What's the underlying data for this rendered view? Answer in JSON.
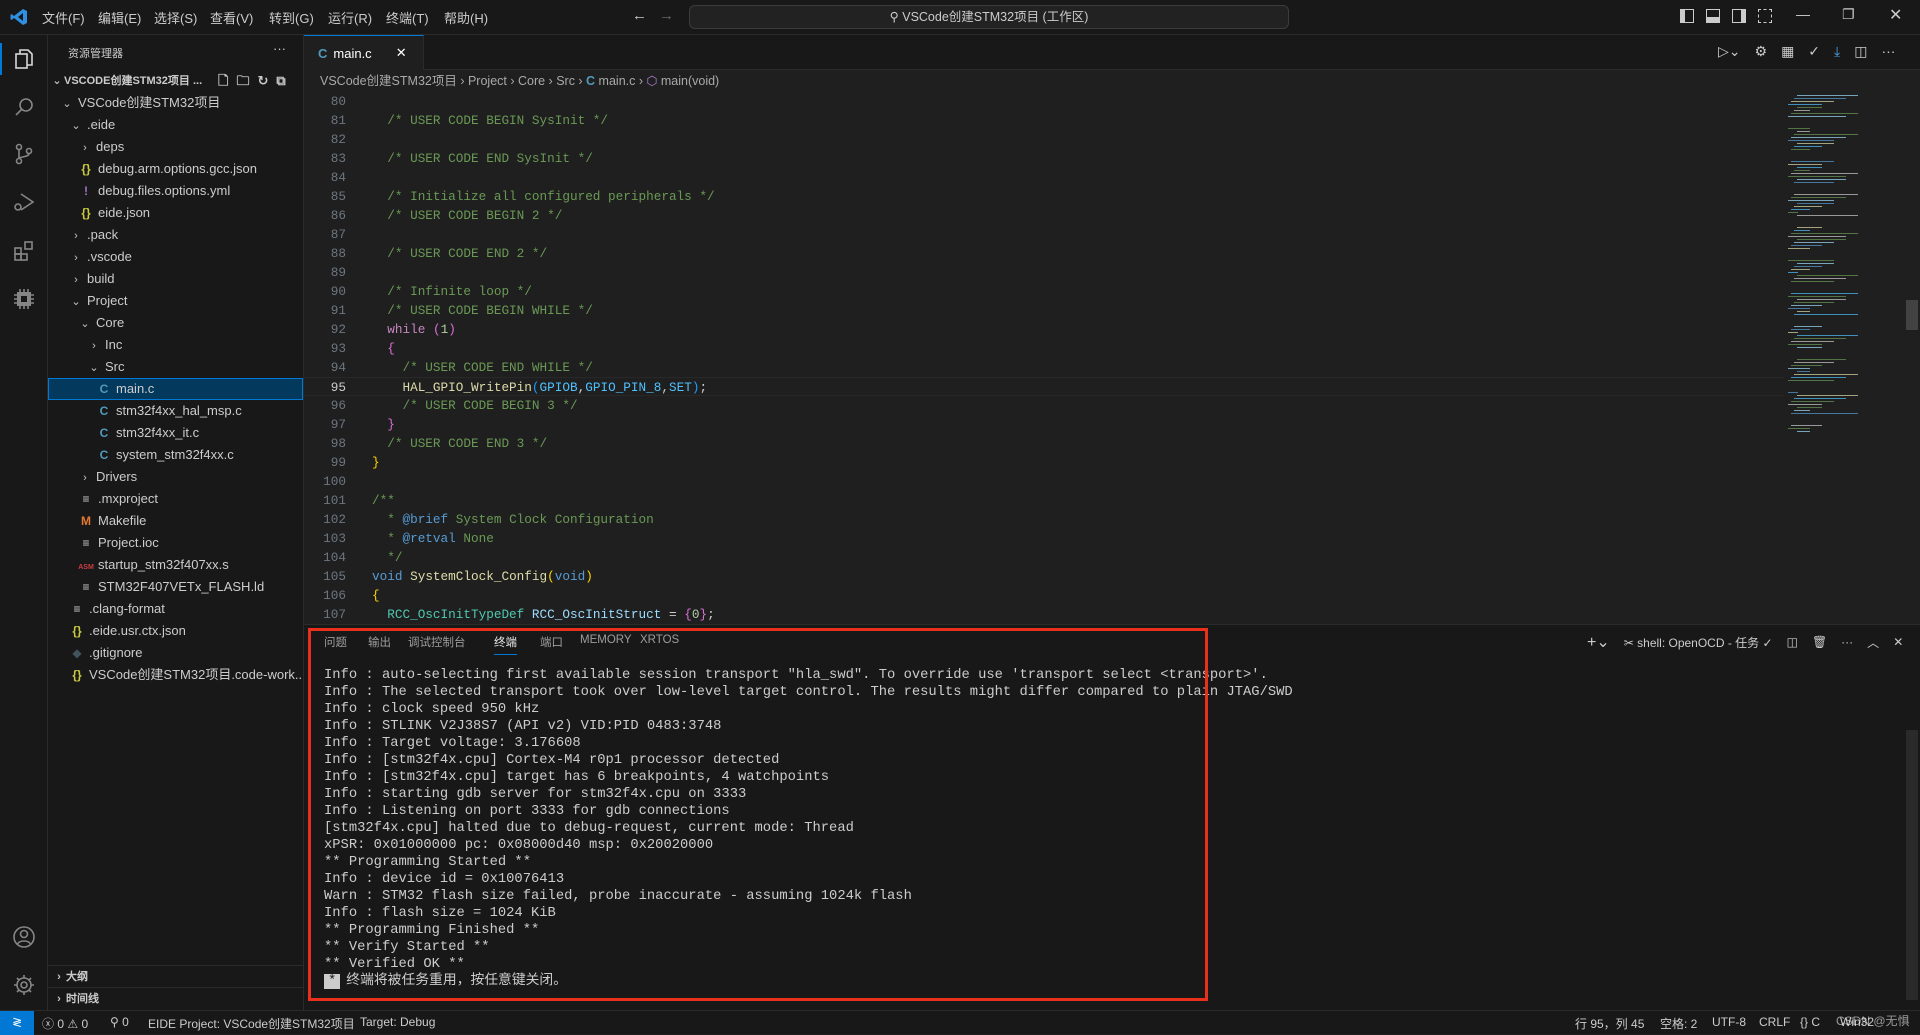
{
  "titlebar": {
    "menus": [
      "文件(F)",
      "编辑(E)",
      "选择(S)",
      "查看(V)",
      "转到(G)",
      "运行(R)",
      "终端(T)",
      "帮助(H)"
    ],
    "search_text": "VSCode创建STM32项目 (工作区)"
  },
  "sidebar": {
    "title": "资源管理器",
    "root": "VSCODE创建STM32项目 ...",
    "items": [
      {
        "label": "VSCode创建STM32项目",
        "level": 0,
        "kind": "folder-open"
      },
      {
        "label": ".eide",
        "level": 1,
        "kind": "folder-open"
      },
      {
        "label": "deps",
        "level": 2,
        "kind": "folder"
      },
      {
        "label": "debug.arm.options.gcc.json",
        "level": 2,
        "kind": "json"
      },
      {
        "label": "debug.files.options.yml",
        "level": 2,
        "kind": "yml"
      },
      {
        "label": "eide.json",
        "level": 2,
        "kind": "json"
      },
      {
        "label": ".pack",
        "level": 1,
        "kind": "folder"
      },
      {
        "label": ".vscode",
        "level": 1,
        "kind": "folder"
      },
      {
        "label": "build",
        "level": 1,
        "kind": "folder"
      },
      {
        "label": "Project",
        "level": 1,
        "kind": "folder-open"
      },
      {
        "label": "Core",
        "level": 2,
        "kind": "folder-open"
      },
      {
        "label": "Inc",
        "level": 3,
        "kind": "folder"
      },
      {
        "label": "Src",
        "level": 3,
        "kind": "folder-open"
      },
      {
        "label": "main.c",
        "level": 4,
        "kind": "c",
        "selected": true
      },
      {
        "label": "stm32f4xx_hal_msp.c",
        "level": 4,
        "kind": "c"
      },
      {
        "label": "stm32f4xx_it.c",
        "level": 4,
        "kind": "c"
      },
      {
        "label": "system_stm32f4xx.c",
        "level": 4,
        "kind": "c"
      },
      {
        "label": "Drivers",
        "level": 2,
        "kind": "folder"
      },
      {
        "label": ".mxproject",
        "level": 2,
        "kind": "text"
      },
      {
        "label": "Makefile",
        "level": 2,
        "kind": "makefile"
      },
      {
        "label": "Project.ioc",
        "level": 2,
        "kind": "text"
      },
      {
        "label": "startup_stm32f407xx.s",
        "level": 2,
        "kind": "asm"
      },
      {
        "label": "STM32F407VETx_FLASH.ld",
        "level": 2,
        "kind": "text"
      },
      {
        "label": ".clang-format",
        "level": 1,
        "kind": "text"
      },
      {
        "label": ".eide.usr.ctx.json",
        "level": 1,
        "kind": "json"
      },
      {
        "label": ".gitignore",
        "level": 1,
        "kind": "git"
      },
      {
        "label": "VSCode创建STM32项目.code-work...",
        "level": 1,
        "kind": "json"
      }
    ],
    "outline": "大纲",
    "timeline": "时间线"
  },
  "editor": {
    "tab_label": "main.c",
    "breadcrumb": [
      "VSCode创建STM32项目",
      "Project",
      "Core",
      "Src",
      "main.c",
      "main(void)"
    ],
    "current_line": 95,
    "lines": [
      {
        "n": 80,
        "t": []
      },
      {
        "n": 81,
        "t": [
          [
            "  ",
            "plain"
          ],
          [
            "/* USER CODE BEGIN SysInit */",
            "comment"
          ]
        ]
      },
      {
        "n": 82,
        "t": []
      },
      {
        "n": 83,
        "t": [
          [
            "  ",
            "plain"
          ],
          [
            "/* USER CODE END SysInit */",
            "comment"
          ]
        ]
      },
      {
        "n": 84,
        "t": []
      },
      {
        "n": 85,
        "t": [
          [
            "  ",
            "plain"
          ],
          [
            "/* Initialize all configured peripherals */",
            "comment"
          ]
        ]
      },
      {
        "n": 86,
        "t": [
          [
            "  ",
            "plain"
          ],
          [
            "/* USER CODE BEGIN 2 */",
            "comment"
          ]
        ]
      },
      {
        "n": 87,
        "t": []
      },
      {
        "n": 88,
        "t": [
          [
            "  ",
            "plain"
          ],
          [
            "/* USER CODE END 2 */",
            "comment"
          ]
        ]
      },
      {
        "n": 89,
        "t": []
      },
      {
        "n": 90,
        "t": [
          [
            "  ",
            "plain"
          ],
          [
            "/* Infinite loop */",
            "comment"
          ]
        ]
      },
      {
        "n": 91,
        "t": [
          [
            "  ",
            "plain"
          ],
          [
            "/* USER CODE BEGIN WHILE */",
            "comment"
          ]
        ]
      },
      {
        "n": 92,
        "t": [
          [
            "  ",
            "plain"
          ],
          [
            "while",
            "control"
          ],
          [
            " ",
            "plain"
          ],
          [
            "(",
            "b2"
          ],
          [
            "1",
            "num"
          ],
          [
            ")",
            "b2"
          ]
        ]
      },
      {
        "n": 93,
        "t": [
          [
            "  ",
            "plain"
          ],
          [
            "{",
            "b2"
          ]
        ]
      },
      {
        "n": 94,
        "t": [
          [
            "    ",
            "plain"
          ],
          [
            "/* USER CODE END WHILE */",
            "comment"
          ]
        ]
      },
      {
        "n": 95,
        "t": [
          [
            "    ",
            "plain"
          ],
          [
            "HAL_GPIO_WritePin",
            "func"
          ],
          [
            "(",
            "b3"
          ],
          [
            "GPIOB",
            "macro"
          ],
          [
            ",",
            "plain"
          ],
          [
            "GPIO_PIN_8",
            "macro"
          ],
          [
            ",",
            "plain"
          ],
          [
            "SET",
            "macro"
          ],
          [
            ")",
            "b3"
          ],
          [
            ";",
            "plain"
          ]
        ]
      },
      {
        "n": 96,
        "t": [
          [
            "    ",
            "plain"
          ],
          [
            "/* USER CODE BEGIN 3 */",
            "comment"
          ]
        ]
      },
      {
        "n": 97,
        "t": [
          [
            "  ",
            "plain"
          ],
          [
            "}",
            "b2"
          ]
        ]
      },
      {
        "n": 98,
        "t": [
          [
            "  ",
            "plain"
          ],
          [
            "/* USER CODE END 3 */",
            "comment"
          ]
        ]
      },
      {
        "n": 99,
        "t": [
          [
            "}",
            "b1"
          ]
        ]
      },
      {
        "n": 100,
        "t": []
      },
      {
        "n": 101,
        "t": [
          [
            "/**",
            "comment"
          ]
        ]
      },
      {
        "n": 102,
        "t": [
          [
            "  * ",
            "comment"
          ],
          [
            "@brief",
            "doc"
          ],
          [
            " System Clock Configuration",
            "comment"
          ]
        ]
      },
      {
        "n": 103,
        "t": [
          [
            "  * ",
            "comment"
          ],
          [
            "@retval",
            "doc"
          ],
          [
            " None",
            "comment"
          ]
        ]
      },
      {
        "n": 104,
        "t": [
          [
            "  */",
            "comment"
          ]
        ]
      },
      {
        "n": 105,
        "t": [
          [
            "void",
            "keyword"
          ],
          [
            " ",
            "plain"
          ],
          [
            "SystemClock_Config",
            "func"
          ],
          [
            "(",
            "b1"
          ],
          [
            "void",
            "keyword"
          ],
          [
            ")",
            "b1"
          ]
        ]
      },
      {
        "n": 106,
        "t": [
          [
            "{",
            "b1"
          ]
        ]
      },
      {
        "n": 107,
        "t": [
          [
            "  ",
            "plain"
          ],
          [
            "RCC_OscInitTypeDef",
            "type"
          ],
          [
            " ",
            "plain"
          ],
          [
            "RCC_OscInitStruct",
            "var"
          ],
          [
            " = ",
            "plain"
          ],
          [
            "{",
            "b2"
          ],
          [
            "0",
            "num"
          ],
          [
            "}",
            "b2"
          ],
          [
            ";",
            "plain"
          ]
        ]
      }
    ]
  },
  "panel": {
    "tabs": [
      "问题",
      "输出",
      "调试控制台",
      "终端",
      "端口",
      "MEMORY",
      "XRTOS"
    ],
    "active_tab": "终端",
    "terminal_name": "shell: OpenOCD - 任务",
    "terminal_lines": [
      "Info : auto-selecting first available session transport \"hla_swd\". To override use 'transport select <transport>'.",
      "Info : The selected transport took over low-level target control. The results might differ compared to plain JTAG/SWD",
      "Info : clock speed 950 kHz",
      "Info : STLINK V2J38S7 (API v2) VID:PID 0483:3748",
      "Info : Target voltage: 3.176608",
      "Info : [stm32f4x.cpu] Cortex-M4 r0p1 processor detected",
      "Info : [stm32f4x.cpu] target has 6 breakpoints, 4 watchpoints",
      "Info : starting gdb server for stm32f4x.cpu on 3333",
      "Info : Listening on port 3333 for gdb connections",
      "[stm32f4x.cpu] halted due to debug-request, current mode: Thread",
      "xPSR: 0x01000000 pc: 0x08000d40 msp: 0x20020000",
      "** Programming Started **",
      "Info : device id = 0x10076413",
      "Warn : STM32 flash size failed, probe inaccurate - assuming 1024k flash",
      "Info : flash size = 1024 KiB",
      "** Programming Finished **",
      "** Verify Started **",
      "** Verified OK **"
    ],
    "final_line_marker": "*",
    "final_line": "终端将被任务重用，按任意键关闭。"
  },
  "statusbar": {
    "errors": "0",
    "warnings": "0",
    "ports": "0",
    "eide_project": "EIDE Project: VSCode创建STM32项目",
    "target": "Target: Debug",
    "position": "行 95，列 45",
    "spaces": "空格: 2",
    "encoding": "UTF-8",
    "eol": "CRLF",
    "language": "C",
    "platform": "Win32",
    "watermark": "CSDN @无惧"
  },
  "colors": {
    "accent": "#0078d4",
    "highlight_box": "#e8301c",
    "selection": "#04395e"
  }
}
